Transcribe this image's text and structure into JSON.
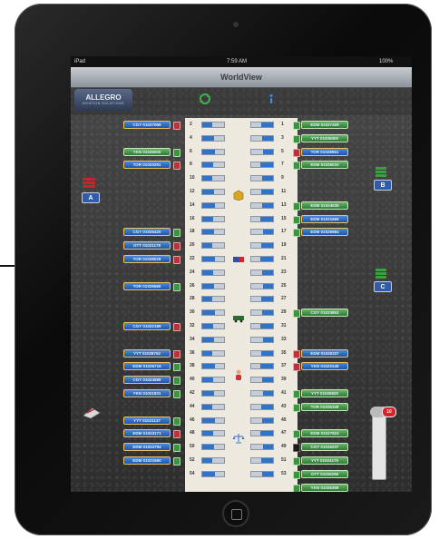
{
  "status_bar": {
    "carrier": "iPad",
    "time": "7:59 AM",
    "battery": "100%"
  },
  "app": {
    "title": "WorldView",
    "logo_text": "ALLEGRO",
    "logo_subtitle": "AVIATION SOLUTIONS"
  },
  "stations": [
    {
      "label": "A",
      "icon": "robot-stack-icon"
    },
    {
      "label": "B",
      "icon": "robot-stack-icon"
    },
    {
      "label": "C",
      "icon": "robot-stack-icon"
    }
  ],
  "gauge": {
    "badge": "10",
    "fill_percent": 0
  },
  "aisle_icons": [
    "package-icon",
    "flag-icon",
    "vehicle-icon",
    "person-icon",
    "scale-icon"
  ],
  "rows": [
    {
      "left": "2",
      "right": "1",
      "lfill": 0.45,
      "rfill": 0.55
    },
    {
      "left": "4",
      "right": "3",
      "lfill": 0.55,
      "rfill": 0.5
    },
    {
      "left": "6",
      "right": "5",
      "lfill": 0.6,
      "rfill": 0.45
    },
    {
      "left": "8",
      "right": "7",
      "lfill": 0.5,
      "rfill": 0.6
    },
    {
      "left": "10",
      "right": "9",
      "lfill": 0.45,
      "rfill": 0.5
    },
    {
      "left": "12",
      "right": "11",
      "lfill": 0.55,
      "rfill": 0.55
    },
    {
      "left": "14",
      "right": "13",
      "lfill": 0.6,
      "rfill": 0.5
    },
    {
      "left": "16",
      "right": "15",
      "lfill": 0.5,
      "rfill": 0.6
    },
    {
      "left": "18",
      "right": "17",
      "lfill": 0.55,
      "rfill": 0.45
    },
    {
      "left": "20",
      "right": "19",
      "lfill": 0.45,
      "rfill": 0.55
    },
    {
      "left": "22",
      "right": "21",
      "lfill": 0.6,
      "rfill": 0.6
    },
    {
      "left": "24",
      "right": "23",
      "lfill": 0.5,
      "rfill": 0.5
    },
    {
      "left": "26",
      "right": "25",
      "lfill": 0.55,
      "rfill": 0.45
    },
    {
      "left": "28",
      "right": "27",
      "lfill": 0.45,
      "rfill": 0.55
    },
    {
      "left": "30",
      "right": "29",
      "lfill": 0.6,
      "rfill": 0.5
    },
    {
      "left": "32",
      "right": "31",
      "lfill": 0.5,
      "rfill": 0.6
    },
    {
      "left": "34",
      "right": "33",
      "lfill": 0.55,
      "rfill": 0.45
    },
    {
      "left": "36",
      "right": "35",
      "lfill": 0.45,
      "rfill": 0.55
    },
    {
      "left": "38",
      "right": "37",
      "lfill": 0.6,
      "rfill": 0.6
    },
    {
      "left": "40",
      "right": "39",
      "lfill": 0.5,
      "rfill": 0.5
    },
    {
      "left": "42",
      "right": "41",
      "lfill": 0.55,
      "rfill": 0.45
    },
    {
      "left": "44",
      "right": "43",
      "lfill": 0.45,
      "rfill": 0.55
    },
    {
      "left": "46",
      "right": "45",
      "lfill": 0.6,
      "rfill": 0.5
    },
    {
      "left": "48",
      "right": "47",
      "lfill": 0.5,
      "rfill": 0.6
    },
    {
      "left": "50",
      "right": "49",
      "lfill": 0.55,
      "rfill": 0.45
    },
    {
      "left": "52",
      "right": "51",
      "lfill": 0.45,
      "rfill": 0.55
    },
    {
      "left": "54",
      "right": "53",
      "lfill": 0.6,
      "rfill": 0.5
    }
  ],
  "left_tags": [
    {
      "row": 0,
      "text": "CGY 01027069",
      "color": "blue",
      "check": "red"
    },
    {
      "row": 2,
      "text": "YKN 01026000",
      "color": "green",
      "check": "green"
    },
    {
      "row": 3,
      "text": "TOR 01023291",
      "color": "blue",
      "check": "red"
    },
    {
      "row": 8,
      "text": "CGY 01026420",
      "color": "blue",
      "check": "green"
    },
    {
      "row": 9,
      "text": "OTT 01021178",
      "color": "blue",
      "check": "red"
    },
    {
      "row": 10,
      "text": "TOR 01028029",
      "color": "blue",
      "check": "red"
    },
    {
      "row": 12,
      "text": "TOR 01026580",
      "color": "blue",
      "check": "green"
    },
    {
      "row": 15,
      "text": "CGY 01022189",
      "color": "blue",
      "check": "red"
    },
    {
      "row": 17,
      "text": "YYT 01028752",
      "color": "blue",
      "check": "red"
    },
    {
      "row": 18,
      "text": "EDM 01026716",
      "color": "blue",
      "check": "green"
    },
    {
      "row": 19,
      "text": "CGY 01024589",
      "color": "blue",
      "check": "green"
    },
    {
      "row": 20,
      "text": "YKN 01021831",
      "color": "blue",
      "check": "green"
    },
    {
      "row": 22,
      "text": "YYT 01021137",
      "color": "blue",
      "check": "green"
    },
    {
      "row": 23,
      "text": "EDM 01023171",
      "color": "blue",
      "check": "red"
    },
    {
      "row": 24,
      "text": "EDM 01023794",
      "color": "blue",
      "check": "green"
    },
    {
      "row": 25,
      "text": "EDM 01021660",
      "color": "blue",
      "check": "green"
    },
    {
      "row": 29,
      "text": "OTT 01026142",
      "color": "green",
      "check": "green"
    }
  ],
  "right_tags": [
    {
      "row": 0,
      "text": "EDM 01027409",
      "color": "green",
      "check": "green"
    },
    {
      "row": 1,
      "text": "YYT 01026000",
      "color": "green",
      "check": "green"
    },
    {
      "row": 2,
      "text": "TOR 01028961",
      "color": "blue",
      "check": "red"
    },
    {
      "row": 3,
      "text": "EDM 01026010",
      "color": "green",
      "check": "green"
    },
    {
      "row": 6,
      "text": "EDM 01024536",
      "color": "green",
      "check": "green"
    },
    {
      "row": 7,
      "text": "EDM 01021669",
      "color": "blue",
      "check": "green"
    },
    {
      "row": 8,
      "text": "EDM 01026984",
      "color": "blue",
      "check": "green"
    },
    {
      "row": 14,
      "text": "CGY 01023853",
      "color": "green",
      "check": "green"
    },
    {
      "row": 17,
      "text": "EDM 01026337",
      "color": "blue",
      "check": "red"
    },
    {
      "row": 18,
      "text": "YKN 01023148",
      "color": "blue",
      "check": "red"
    },
    {
      "row": 20,
      "text": "YYT 01026820",
      "color": "green",
      "check": "green"
    },
    {
      "row": 21,
      "text": "TOR 01026158",
      "color": "green",
      "check": "green"
    },
    {
      "row": 23,
      "text": "EDM 01027924",
      "color": "green",
      "check": "green"
    },
    {
      "row": 24,
      "text": "CGY 01026237",
      "color": "green",
      "check": "dark"
    },
    {
      "row": 25,
      "text": "YYT 01024175",
      "color": "green",
      "check": "green"
    },
    {
      "row": 26,
      "text": "OTT 01026296",
      "color": "green",
      "check": "green"
    },
    {
      "row": 27,
      "text": "YKN 01026358",
      "color": "green",
      "check": "green"
    }
  ]
}
